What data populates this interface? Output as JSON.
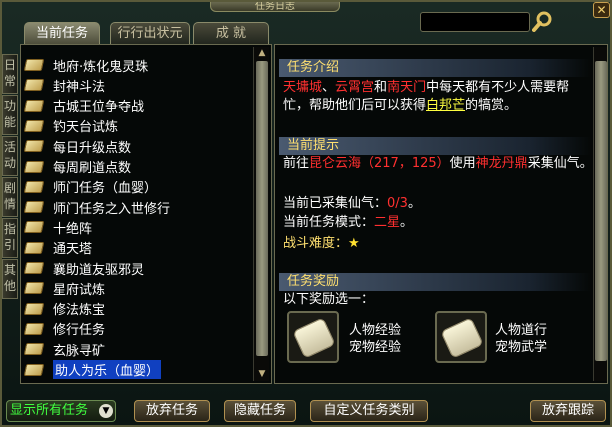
{
  "window": {
    "title": "任务日志"
  },
  "tabs": [
    {
      "label": "当前任务",
      "active": true
    },
    {
      "label": "行行出状元",
      "active": false
    },
    {
      "label": "成  就",
      "active": false
    }
  ],
  "side_tabs": [
    "日常",
    "功能",
    "活动",
    "剧情",
    "指引",
    "其他"
  ],
  "quest_list": [
    "地府·炼化鬼灵珠",
    "封神斗法",
    "古城王位争夺战",
    "钓天台试炼",
    "每日升级点数",
    "每周刷道点数",
    "师门任务（血婴）",
    "师门任务之入世修行",
    "十绝阵",
    "通天塔",
    "襄助道友驱邪灵",
    "星府试炼",
    "修法炼宝",
    "修行任务",
    "玄脉寻矿",
    "助人为乐（血婴）"
  ],
  "selected_quest": "助人为乐（血婴）",
  "detail": {
    "intro_header": "任务介绍",
    "intro": {
      "loc1": "天墉城",
      "sep1": "、",
      "loc2": "云霄宫",
      "and": "和",
      "loc3": "南天门",
      "text1": "中每天都有不少人需要帮忙，帮助他们后可以获得",
      "npc": "白邦芒",
      "text2": "的犒赏。"
    },
    "hint_header": "当前提示",
    "hint": {
      "go": "前往",
      "place": "昆仑云海（217，125）",
      "use": "使用",
      "item": "神龙丹鼎",
      "collect": "采集仙气。"
    },
    "collected_label": "当前已采集仙气：",
    "collected_value": "0/3",
    "collected_end": "。",
    "mode_label": "当前任务模式：",
    "mode_value": "二星",
    "mode_end": "。",
    "difficulty_label": "战斗难度：",
    "difficulty_stars": 1,
    "reward_header": "任务奖励",
    "reward_prompt": "以下奖励选一：",
    "rewards": [
      {
        "line1": "人物经验",
        "line2": "宠物经验"
      },
      {
        "line1": "人物道行",
        "line2": "宠物武学"
      }
    ]
  },
  "bottom": {
    "filter": "显示所有任务",
    "abandon": "放弃任务",
    "hide": "隐藏任务",
    "custom": "自定义任务类别",
    "untrack": "放弃跟踪"
  },
  "colors": {
    "highlight_red": "#ff3030",
    "highlight_yellow": "#ffff40",
    "header_gold": "#ffe070",
    "filter_green": "#40ff40",
    "selection_blue": "#1040c0"
  }
}
